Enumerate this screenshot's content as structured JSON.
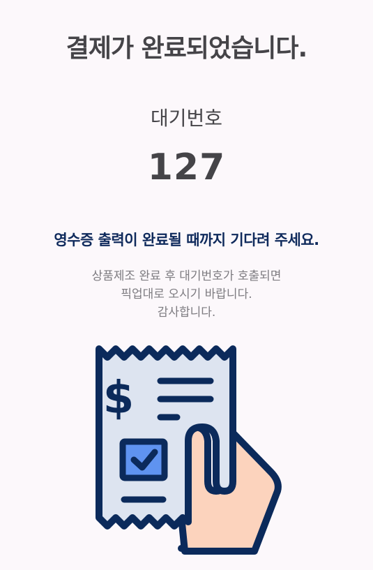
{
  "page": {
    "title": "결제가 완료되었습니다.",
    "wait_label": "대기번호",
    "wait_number": "127",
    "notice": "영수증 출력이 완료될 때까지 기다려 주세요.",
    "description_lines": [
      "상품제조 완료 후 대기번호가 호출되면",
      "픽업대로 오시기 바랍니다.",
      "감사합니다."
    ]
  },
  "illustration": {
    "icon": "receipt-in-hand-icon",
    "colors": {
      "outline": "#0b2a5b",
      "receipt_fill": "#dde4f0",
      "checkbox_fill": "#5f93f0",
      "hand_fill": "#fcd3bd"
    }
  }
}
